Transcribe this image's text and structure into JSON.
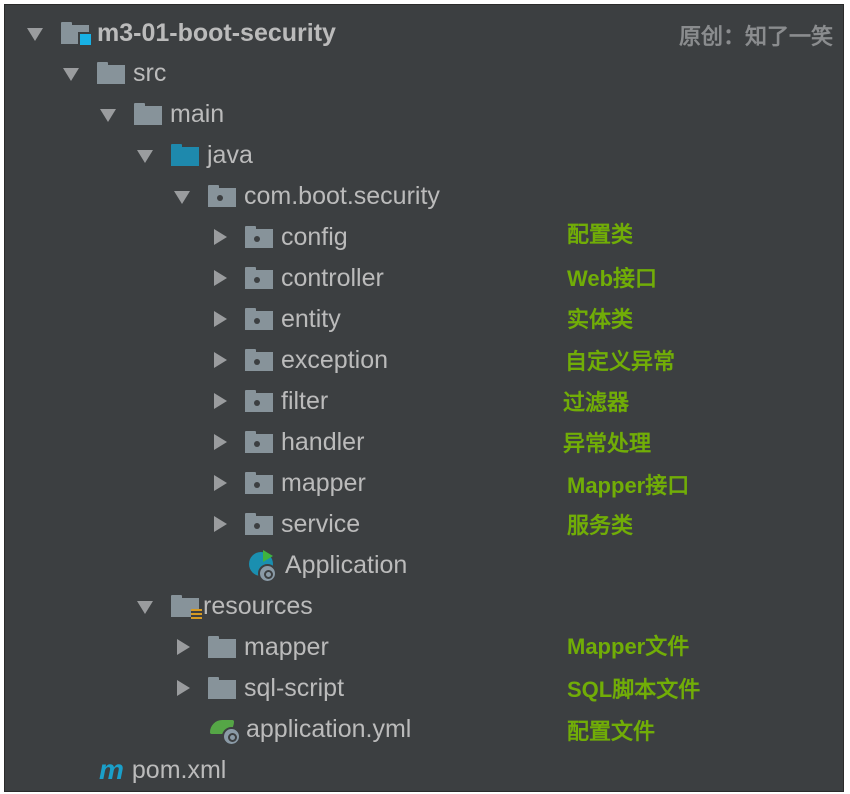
{
  "credit": "原创：知了一笑",
  "tree": {
    "project": "m3-01-boot-security",
    "src": "src",
    "main": "main",
    "java": "java",
    "package": "com.boot.security",
    "packages": [
      {
        "name": "config",
        "note": "配置类"
      },
      {
        "name": "controller",
        "note": "Web接口"
      },
      {
        "name": "entity",
        "note": "实体类"
      },
      {
        "name": "exception",
        "note": "自定义异常"
      },
      {
        "name": "filter",
        "note": "过滤器"
      },
      {
        "name": "handler",
        "note": "异常处理"
      },
      {
        "name": "mapper",
        "note": "Mapper接口"
      },
      {
        "name": "service",
        "note": "服务类"
      }
    ],
    "application_class": "Application",
    "resources": "resources",
    "resource_items": [
      {
        "name": "mapper",
        "note": "Mapper文件"
      },
      {
        "name": "sql-script",
        "note": "SQL脚本文件"
      }
    ],
    "application_yml": {
      "name": "application.yml",
      "note": "配置文件"
    },
    "pom": "pom.xml",
    "maven_glyph": "m"
  },
  "colors": {
    "background": "#3c3f41",
    "note": "#71ad07",
    "text": "#bbbbbb"
  }
}
